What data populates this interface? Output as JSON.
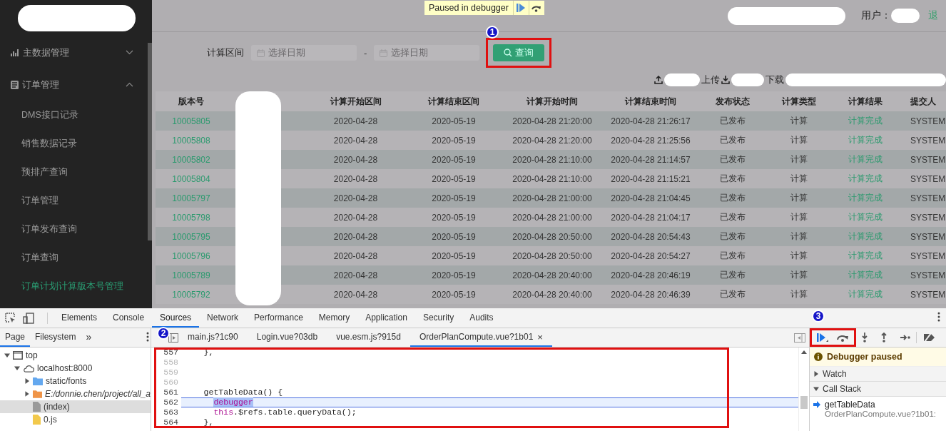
{
  "debugger_banner": {
    "text": "Paused in debugger"
  },
  "sidebar": {
    "items": [
      {
        "label": "主数据管理",
        "expanded": false
      },
      {
        "label": "订单管理",
        "expanded": true,
        "children": [
          {
            "label": "DMS接口记录",
            "selected": false
          },
          {
            "label": "销售数据记录",
            "selected": false
          },
          {
            "label": "预排产查询",
            "selected": false
          },
          {
            "label": "订单管理",
            "selected": false
          },
          {
            "label": "订单发布查询",
            "selected": false
          },
          {
            "label": "订单查询",
            "selected": false
          },
          {
            "label": "订单计划计算版本号管理",
            "selected": true
          }
        ]
      }
    ]
  },
  "header": {
    "user_label": "用户：",
    "logout": "退"
  },
  "filter": {
    "label": "计算区间",
    "date_from": {
      "placeholder": "选择日期"
    },
    "separator": "-",
    "date_to": {
      "placeholder": "选择日期"
    },
    "query_button": "查询",
    "badge": "1"
  },
  "actions": {
    "upload": "上传",
    "download": "下载"
  },
  "table": {
    "columns": [
      {
        "label": "版本号",
        "kind": "link"
      },
      {
        "label": "计算开始区间",
        "kind": "text"
      },
      {
        "label": "计算结束区间",
        "kind": "text"
      },
      {
        "label": "计算开始时间",
        "kind": "text"
      },
      {
        "label": "计算结束时间",
        "kind": "text"
      },
      {
        "label": "发布状态",
        "kind": "text"
      },
      {
        "label": "计算类型",
        "kind": "text"
      },
      {
        "label": "计算结果",
        "kind": "status"
      },
      {
        "label": "提交人",
        "kind": "text"
      }
    ],
    "rows": [
      {
        "cells": [
          "10005805",
          "2020-04-28",
          "2020-05-19",
          "2020-04-28 21:20:00",
          "2020-04-28 21:26:17",
          "已发布",
          "计算",
          "计算完成",
          "SYSTEM"
        ]
      },
      {
        "cells": [
          "10005808",
          "2020-04-28",
          "2020-05-19",
          "2020-04-28 21:20:00",
          "2020-04-28 21:25:56",
          "已发布",
          "计算",
          "计算完成",
          "SYSTEM"
        ]
      },
      {
        "cells": [
          "10005802",
          "2020-04-28",
          "2020-05-19",
          "2020-04-28 21:10:00",
          "2020-04-28 21:14:57",
          "已发布",
          "计算",
          "计算完成",
          "SYSTEM"
        ]
      },
      {
        "cells": [
          "10005804",
          "2020-04-28",
          "2020-05-19",
          "2020-04-28 21:10:00",
          "2020-04-28 21:15:21",
          "已发布",
          "计算",
          "计算完成",
          "SYSTEM"
        ]
      },
      {
        "cells": [
          "10005797",
          "2020-04-28",
          "2020-05-19",
          "2020-04-28 21:00:00",
          "2020-04-28 21:04:45",
          "已发布",
          "计算",
          "计算完成",
          "SYSTEM"
        ]
      },
      {
        "cells": [
          "10005798",
          "2020-04-28",
          "2020-05-19",
          "2020-04-28 21:00:00",
          "2020-04-28 21:04:17",
          "已发布",
          "计算",
          "计算完成",
          "SYSTEM"
        ]
      },
      {
        "cells": [
          "10005795",
          "2020-04-28",
          "2020-05-19",
          "2020-04-28 20:50:00",
          "2020-04-28 20:54:43",
          "已发布",
          "计算",
          "计算完成",
          "SYSTEM"
        ]
      },
      {
        "cells": [
          "10005796",
          "2020-04-28",
          "2020-05-19",
          "2020-04-28 20:50:00",
          "2020-04-28 20:54:27",
          "已发布",
          "计算",
          "计算完成",
          "SYSTEM"
        ]
      },
      {
        "cells": [
          "10005789",
          "2020-04-28",
          "2020-05-19",
          "2020-04-28 20:40:00",
          "2020-04-28 20:46:19",
          "已发布",
          "计算",
          "计算完成",
          "SYSTEM"
        ]
      },
      {
        "cells": [
          "10005792",
          "2020-04-28",
          "2020-05-19",
          "2020-04-28 20:40:00",
          "2020-04-28 20:46:39",
          "已发布",
          "计算",
          "计算完成",
          "SYSTEM"
        ]
      }
    ]
  },
  "devtools": {
    "tabs": [
      {
        "label": "Elements",
        "selected": false
      },
      {
        "label": "Console",
        "selected": false
      },
      {
        "label": "Sources",
        "selected": true
      },
      {
        "label": "Network",
        "selected": false
      },
      {
        "label": "Performance",
        "selected": false
      },
      {
        "label": "Memory",
        "selected": false
      },
      {
        "label": "Application",
        "selected": false
      },
      {
        "label": "Security",
        "selected": false
      },
      {
        "label": "Audits",
        "selected": false
      }
    ],
    "badge": "3",
    "navigator": {
      "tabs": [
        {
          "label": "Page",
          "selected": true
        },
        {
          "label": "Filesystem",
          "selected": false
        }
      ],
      "more": "»",
      "tree": [
        {
          "label": "top",
          "kind": "frame",
          "expanded": true,
          "selected": false,
          "children": [
            {
              "label": "localhost:8000",
              "kind": "cloud",
              "expanded": true,
              "selected": false,
              "children": [
                {
                  "label": "static/fonts",
                  "kind": "folder",
                  "expanded": false,
                  "selected": false
                },
                {
                  "label": "E:/donnie.chen/project/all_a",
                  "kind": "local-folder",
                  "expanded": false,
                  "selected": false
                },
                {
                  "label": "(index)",
                  "kind": "file",
                  "selected": true
                },
                {
                  "label": "0.js",
                  "kind": "script",
                  "selected": false
                }
              ]
            }
          ]
        }
      ]
    },
    "editor": {
      "badge": "2",
      "tabs": [
        {
          "label": "main.js?1c90",
          "selected": false
        },
        {
          "label": "Login.vue?03db",
          "selected": false
        },
        {
          "label": "vue.esm.js?915d",
          "selected": false
        },
        {
          "label": "OrderPlanCompute.vue?1b01",
          "selected": true,
          "close": "×"
        }
      ],
      "lines": [
        {
          "number": "557",
          "dimmed": false,
          "paused": false,
          "tokens": [
            {
              "text": "    },",
              "kind": "plain"
            }
          ]
        },
        {
          "number": "558",
          "dimmed": true,
          "paused": false
        },
        {
          "number": "559",
          "dimmed": true,
          "paused": false
        },
        {
          "number": "560",
          "dimmed": true,
          "paused": false
        },
        {
          "number": "561",
          "dimmed": false,
          "paused": false,
          "tokens": [
            {
              "text": "    getTableData() {",
              "kind": "plain"
            }
          ]
        },
        {
          "number": "562",
          "dimmed": false,
          "paused": true,
          "tokens": [
            {
              "text": "      debugger",
              "kind": "selected-keyword"
            }
          ]
        },
        {
          "number": "563",
          "dimmed": false,
          "paused": false,
          "tokens": [
            {
              "text": "      this",
              "kind": "keyword"
            },
            {
              "text": ".$refs.table.queryData();",
              "kind": "plain"
            }
          ]
        },
        {
          "number": "564",
          "dimmed": false,
          "paused": false,
          "tokens": [
            {
              "text": "    },",
              "kind": "plain"
            }
          ]
        }
      ]
    },
    "debugger": {
      "paused_banner": "Debugger paused",
      "sections": [
        {
          "label": "Watch",
          "expanded": false
        },
        {
          "label": "Call Stack",
          "expanded": true
        }
      ],
      "call_stack": [
        {
          "function": "getTableData",
          "location": "OrderPlanCompute.vue?1b01:",
          "selected": true
        }
      ]
    }
  }
}
